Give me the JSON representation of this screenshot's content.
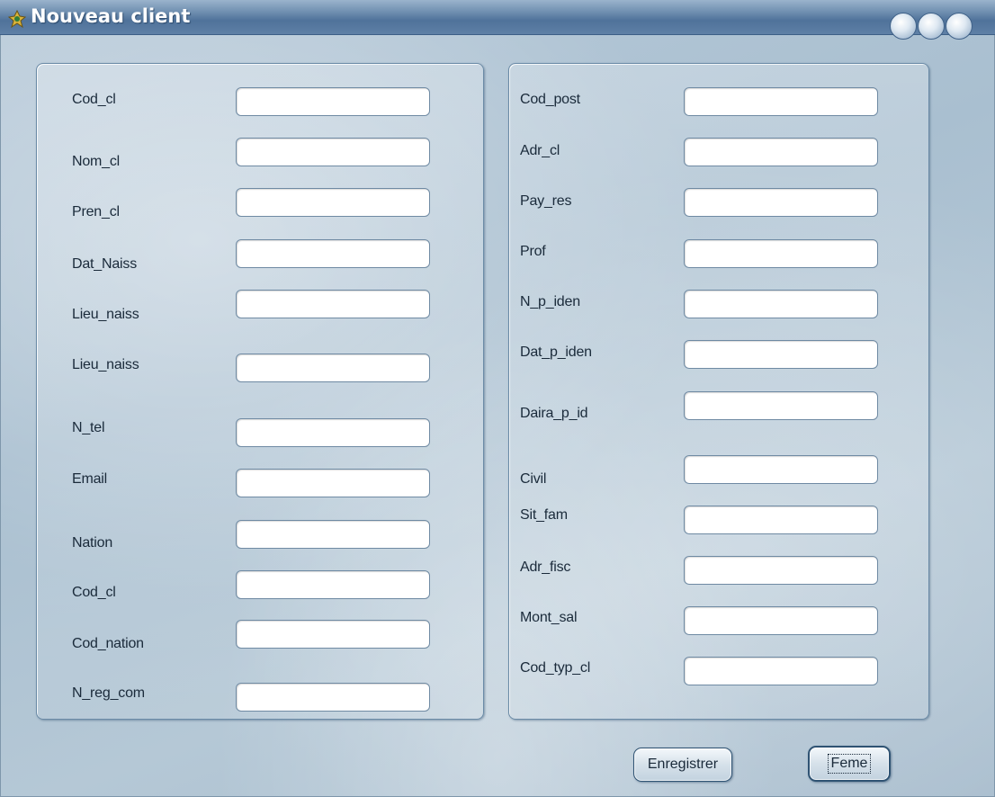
{
  "window": {
    "title": "Nouveau client"
  },
  "left_panel": {
    "fields": [
      {
        "label": "Cod_cl",
        "value": ""
      },
      {
        "label": "Nom_cl",
        "value": ""
      },
      {
        "label": "Pren_cl",
        "value": ""
      },
      {
        "label": "Dat_Naiss",
        "value": ""
      },
      {
        "label": "Lieu_naiss",
        "value": ""
      },
      {
        "label": "Lieu_naiss",
        "value": ""
      },
      {
        "label": "N_tel",
        "value": ""
      },
      {
        "label": "Email",
        "value": ""
      },
      {
        "label": "Nation",
        "value": ""
      },
      {
        "label": "Cod_cl",
        "value": ""
      },
      {
        "label": "Cod_nation",
        "value": ""
      },
      {
        "label": "N_reg_com",
        "value": ""
      }
    ]
  },
  "right_panel": {
    "fields": [
      {
        "label": "Cod_post",
        "value": ""
      },
      {
        "label": "Adr_cl",
        "value": ""
      },
      {
        "label": "Pay_res",
        "value": ""
      },
      {
        "label": "Prof",
        "value": ""
      },
      {
        "label": "N_p_iden",
        "value": ""
      },
      {
        "label": "Dat_p_iden",
        "value": ""
      },
      {
        "label": "Daira_p_id",
        "value": ""
      },
      {
        "label": "Civil",
        "value": ""
      },
      {
        "label": "Sit_fam",
        "value": ""
      },
      {
        "label": "Adr_fisc",
        "value": ""
      },
      {
        "label": "Mont_sal",
        "value": ""
      },
      {
        "label": "Cod_typ_cl",
        "value": ""
      }
    ]
  },
  "buttons": {
    "save_label": "Enregistrer",
    "close_label": "Feme"
  }
}
